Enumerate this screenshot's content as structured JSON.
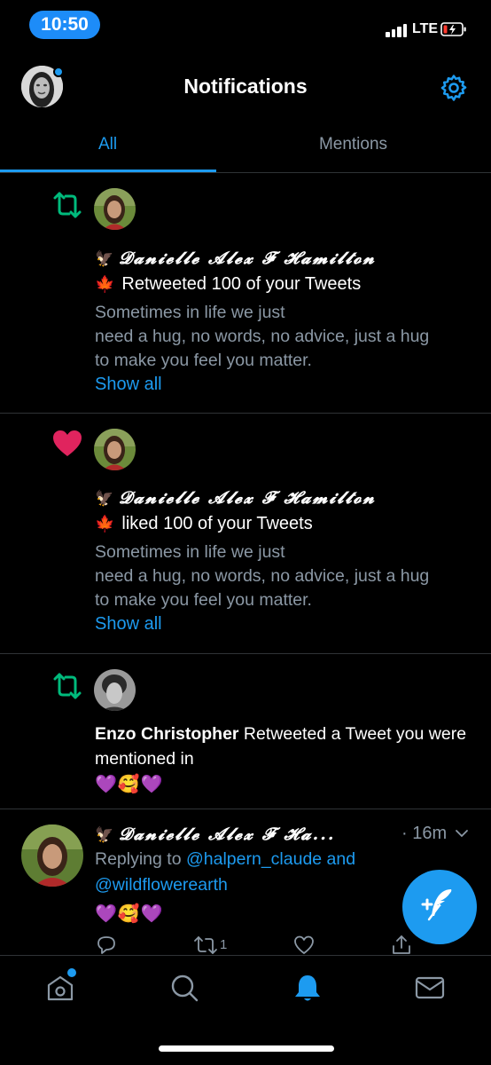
{
  "status_bar": {
    "time": "10:50",
    "network": "LTE"
  },
  "header": {
    "title": "Notifications"
  },
  "tabs": [
    {
      "label": "All"
    },
    {
      "label": "Mentions"
    }
  ],
  "notifications": [
    {
      "type": "retweet",
      "name": "𝓓𝓪𝓷𝓲𝓮𝓵𝓵𝓮 𝓐𝓵𝓮𝔁 𝓕 𝓗𝓪𝓶𝓲𝓵𝓽𝓸𝓷",
      "action": "Retweeted 100 of your Tweets",
      "text_line1": "Sometimes in life we just",
      "text_line2": "need a hug, no words, no advice, just a hug",
      "text_line3": "to make you feel you matter.",
      "show_all": "Show all"
    },
    {
      "type": "like",
      "name": "𝓓𝓪𝓷𝓲𝓮𝓵𝓵𝓮 𝓐𝓵𝓮𝔁 𝓕 𝓗𝓪𝓶𝓲𝓵𝓽𝓸𝓷",
      "action": "liked 100 of your Tweets",
      "text_line1": "Sometimes in life we just",
      "text_line2": "need a hug, no words, no advice, just a hug",
      "text_line3": "to make you feel you matter.",
      "show_all": "Show all"
    },
    {
      "type": "retweet",
      "user": "Enzo Christopher",
      "action": " Retweeted a Tweet you were mentioned in",
      "emojis": "💜🥰💜"
    }
  ],
  "tweet": {
    "name": "𝓓𝓪𝓷𝓲𝓮𝓵𝓵𝓮 𝓐𝓵𝓮𝔁 𝓕 𝓗𝓪...",
    "time": "· 16m",
    "replying_to_prefix": "Replying to ",
    "handle1": "@halpern_claude",
    "and": " and",
    "handle2": "@wildflowerearth",
    "emojis": "💜🥰💜",
    "retweet_count": "1"
  },
  "icons": {
    "retweet": "retweet-icon",
    "like": "heart-icon",
    "settings": "gear-icon",
    "home": "home-icon",
    "search": "search-icon",
    "notifications": "bell-icon",
    "messages": "mail-icon",
    "compose": "compose-icon"
  },
  "colors": {
    "accent": "#1d9bf0",
    "retweet": "#00ba7c",
    "like": "#f91880",
    "time_pill": "#1d8cf8"
  }
}
